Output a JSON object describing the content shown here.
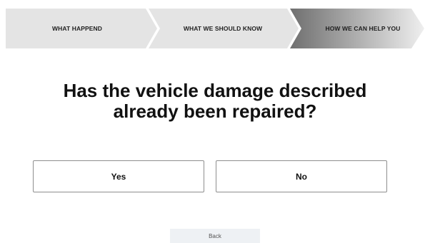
{
  "stepper": {
    "steps": [
      {
        "label": "WHAT HAPPEND",
        "state": "completed"
      },
      {
        "label": "WHAT WE SHOULD KNOW",
        "state": "completed"
      },
      {
        "label": "HOW WE CAN HELP YOU",
        "state": "active"
      }
    ],
    "colors": {
      "completed": "#e4e4e4",
      "active_dark": "#6f6f6f",
      "active_light": "#efefef"
    }
  },
  "question": {
    "line1": "Has the vehicle damage described",
    "line2": "already been repaired?"
  },
  "answers": {
    "yes_label": "Yes",
    "no_label": "No"
  },
  "navigation": {
    "back_label": "Back"
  }
}
